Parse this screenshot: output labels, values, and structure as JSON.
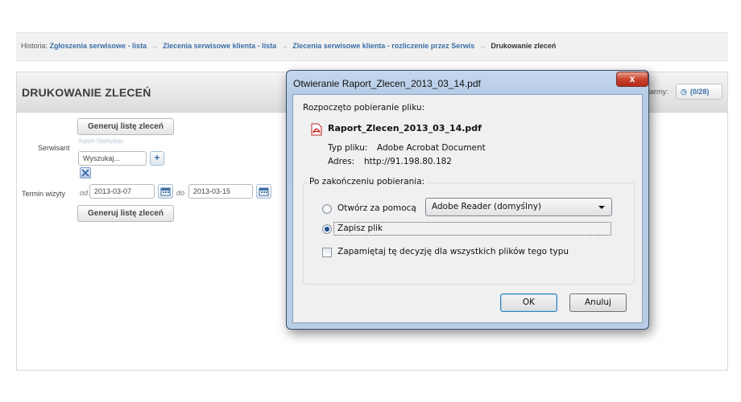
{
  "breadcrumb": {
    "prefix": "Historia:",
    "links": [
      "Zgłoszenia serwisowe - lista",
      "Zlecenia serwisowe klienta - lista",
      "Zlecenia serwisowe klienta - rozliczenie przez Serwis"
    ],
    "arrow": "→",
    "current": "Drukowanie zleceń"
  },
  "panel": {
    "title": "DRUKOWANIE ZLECEŃ",
    "alarm_label": "larmy:",
    "alarm_count": "(0/28)",
    "generate_label": "Generuj listę zleceń",
    "serwisant_label": "Serwisant",
    "serwisant_blurred": "Adam Niebykan",
    "search_value": "Wyszukaj...",
    "plus": "+",
    "termin_label": "Termin wizyty",
    "od": "od",
    "date_from": "2013-03-07",
    "do": "do",
    "date_to": "2013-03-15"
  },
  "dialog": {
    "title": "Otwieranie Raport_Zlecen_2013_03_14.pdf",
    "close": "x",
    "started": "Rozpoczęto pobieranie pliku:",
    "filename": "Raport_Zlecen_2013_03_14.pdf",
    "type_label": "Typ pliku:",
    "type_value": "Adobe Acrobat Document",
    "address_label": "Adres:",
    "address_value": "http://91.198.80.182",
    "group_label": "Po zakończeniu pobierania:",
    "open_with": "Otwórz za pomocą",
    "open_app": "Adobe Reader  (domyślny)",
    "save_file": "Zapisz plik",
    "remember": "Zapamiętaj tę decyzję dla wszystkich plików tego typu",
    "ok": "OK",
    "cancel": "Anuluj"
  }
}
